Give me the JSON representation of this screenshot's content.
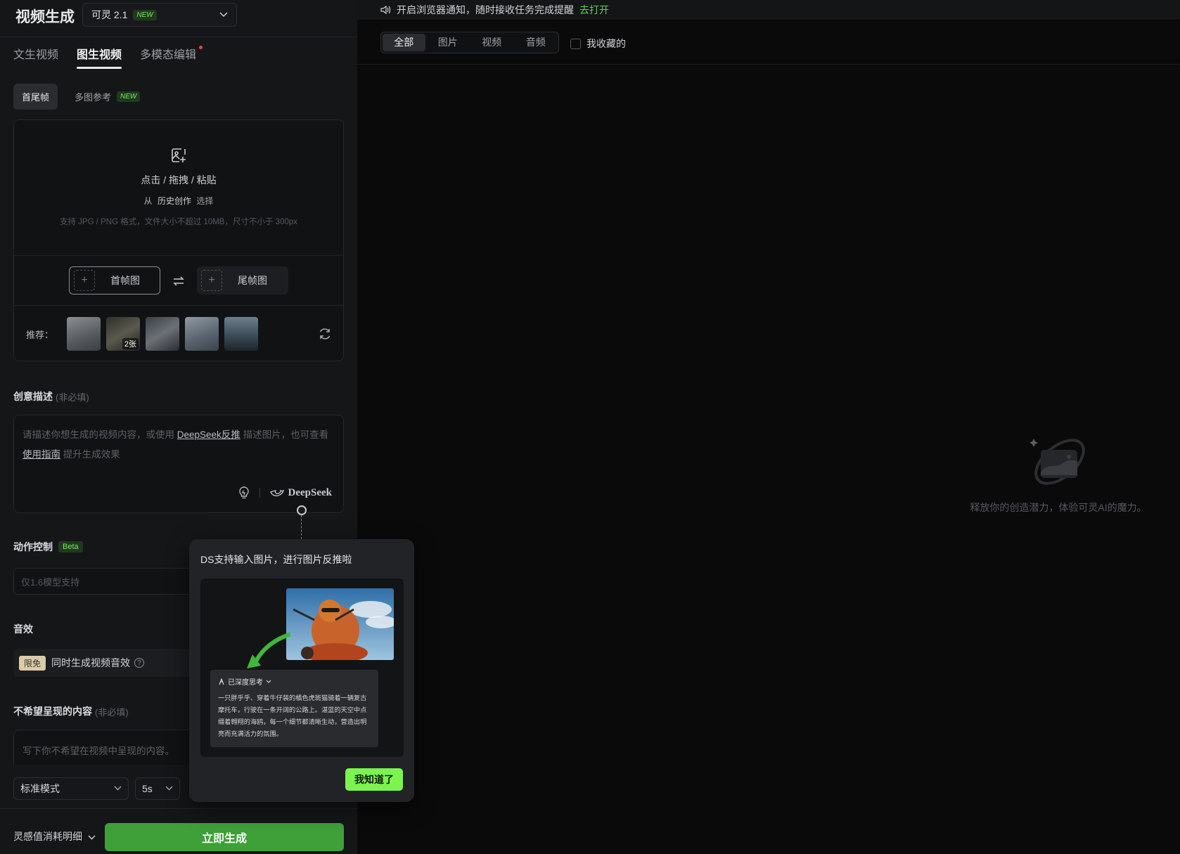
{
  "header": {
    "title": "视频生成",
    "model": "可灵 2.1",
    "new_badge": "NEW"
  },
  "tabs": [
    {
      "label": "文生视频",
      "active": false
    },
    {
      "label": "图生视频",
      "active": true
    },
    {
      "label": "多模态编辑",
      "active": false,
      "dot": true
    }
  ],
  "subtabs": [
    {
      "label": "首尾帧",
      "active": true
    },
    {
      "label": "多图参考",
      "badge": "NEW"
    }
  ],
  "upload": {
    "main": "点击 / 拖拽 / 粘贴",
    "from": "从",
    "history": "历史创作",
    "select": "选择",
    "hint": "支持 JPG / PNG 格式，文件大小不超过 10MB，尺寸不小于 300px",
    "first_frame": "首帧图",
    "last_frame": "尾帧图",
    "recommend_label": "推荐：",
    "thumb_count": "2张"
  },
  "description": {
    "label": "创意描述",
    "optional": "(非必填)",
    "placeholder_1": "请描述你想生成的视频内容，或使用 ",
    "link_ds": "DeepSeek反推",
    "placeholder_2": " 描述图片，也可查看 ",
    "link_guide": "使用指南",
    "placeholder_3": " 提升生成效果",
    "ds_brand": "DeepSeek"
  },
  "motion": {
    "label": "动作控制",
    "badge": "Beta",
    "placeholder": "仅1.6模型支持"
  },
  "sfx": {
    "label": "音效",
    "free": "限免",
    "text": "同时生成视频音效",
    "help": "?"
  },
  "negative": {
    "label": "不希望呈现的内容",
    "optional": "(非必填)",
    "placeholder": "写下你不希望在视频中呈现的内容。"
  },
  "settings": {
    "mode": "标准模式",
    "duration": "5s"
  },
  "footer": {
    "cost": "灵感值消耗明细",
    "generate": "立即生成"
  },
  "notify": {
    "text": "开启浏览器通知，随时接收任务完成提醒",
    "action": "去打开"
  },
  "filters": [
    {
      "label": "全部",
      "active": true
    },
    {
      "label": "图片"
    },
    {
      "label": "视频"
    },
    {
      "label": "音频"
    }
  ],
  "favorites": "我收藏的",
  "empty_text": "释放你的创造潜力，体验可灵AI的魔力。",
  "popover": {
    "title": "DS支持输入图片，进行图片反推啦",
    "card_head": "已深度思考",
    "card_text": "一只胖乎乎、穿着牛仔装的橘色虎斑猫骑着一辆复古摩托车，行驶在一条开阔的公路上。湛蓝的天空中点缀着翱翔的海鸥，每一个细节都清晰生动，营造出明亮而充满活力的氛围。",
    "ok": "我知道了"
  },
  "colors": {
    "accent_green": "#3f9f39",
    "popover_button": "#7cf34f",
    "badge_green": "#7fe06b"
  }
}
